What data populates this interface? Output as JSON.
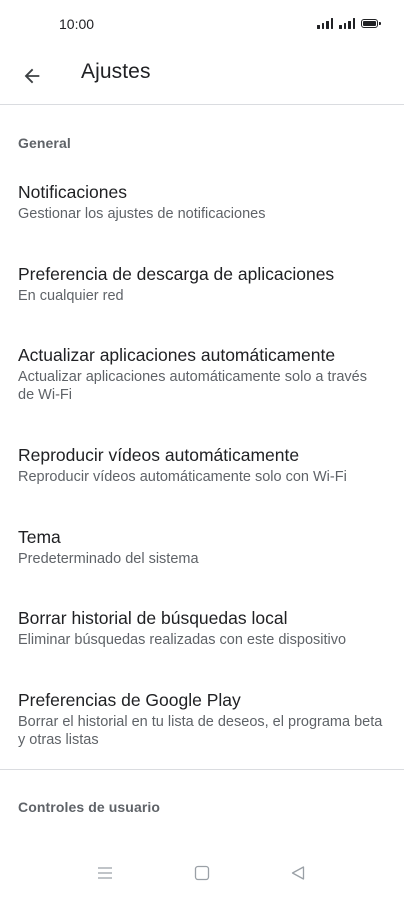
{
  "status_bar": {
    "time": "10:00"
  },
  "header": {
    "title": "Ajustes"
  },
  "sections": [
    {
      "label": "General"
    },
    {
      "label": "Controles de usuario"
    }
  ],
  "settings": [
    {
      "title": "Notificaciones",
      "subtitle": "Gestionar los ajustes de notificaciones"
    },
    {
      "title": "Preferencia de descarga de aplicaciones",
      "subtitle": "En cualquier red"
    },
    {
      "title": "Actualizar aplicaciones automáticamente",
      "subtitle": "Actualizar aplicaciones automáticamente solo a través de Wi-Fi"
    },
    {
      "title": "Reproducir vídeos automáticamente",
      "subtitle": "Reproducir vídeos automáticamente solo con Wi-Fi"
    },
    {
      "title": "Tema",
      "subtitle": "Predeterminado del sistema"
    },
    {
      "title": "Borrar historial de búsquedas local",
      "subtitle": "Eliminar búsquedas realizadas con este dispositivo"
    },
    {
      "title": "Preferencias de Google Play",
      "subtitle": "Borrar el historial en tu lista de deseos, el programa beta y otras listas"
    }
  ],
  "icons": {
    "back": "arrow-back-icon",
    "nav_menu": "menu-icon",
    "nav_home": "home-square-icon",
    "nav_back": "back-triangle-icon"
  }
}
